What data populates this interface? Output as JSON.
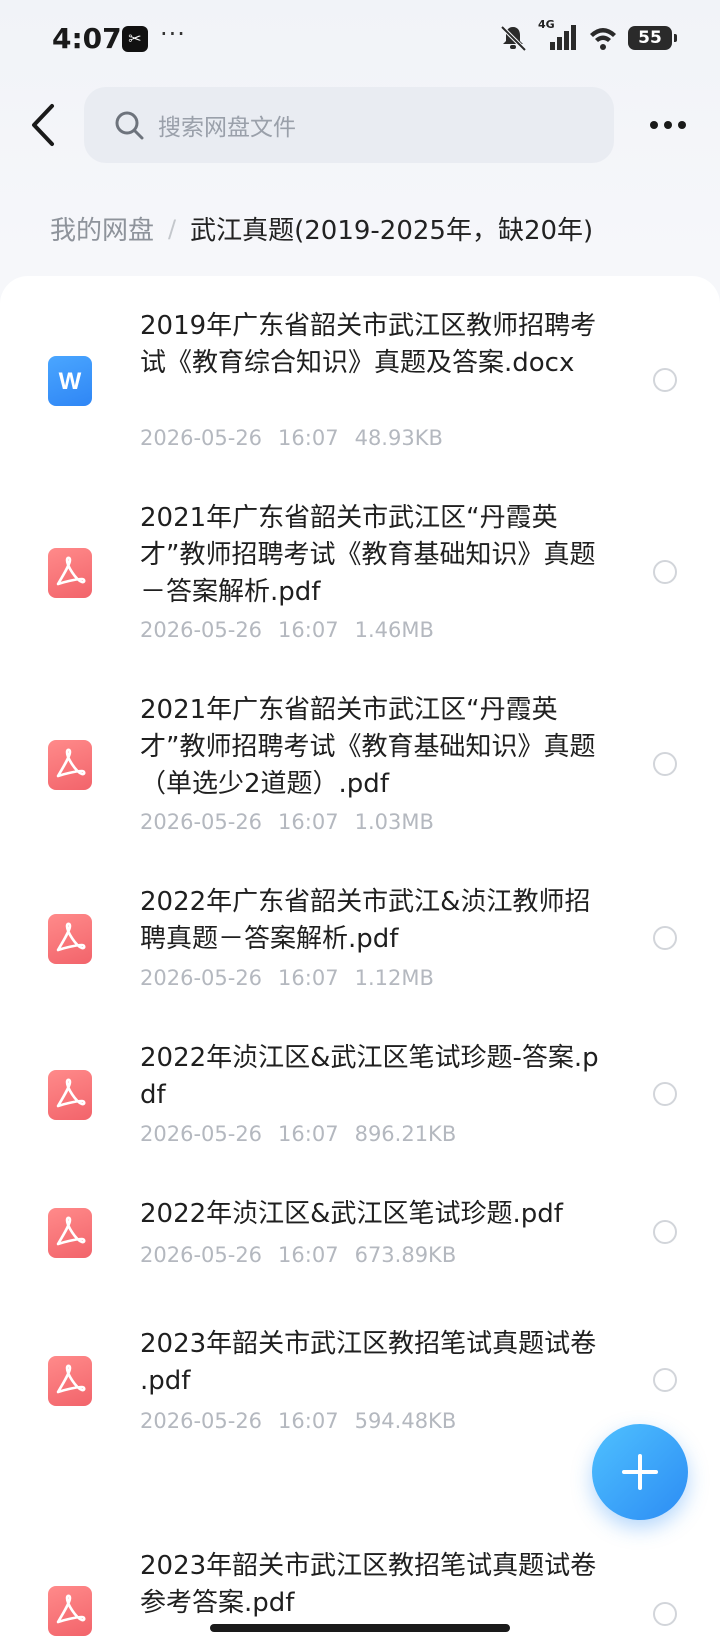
{
  "status_bar": {
    "time": "4:07",
    "dots": "···",
    "network": "4G",
    "battery": "55",
    "app_icon_text": "✂"
  },
  "header": {
    "search_placeholder": "搜索网盘文件"
  },
  "breadcrumb": {
    "root": "我的网盘",
    "separator": "/",
    "current": "武江真题(2019-2025年，缺20年)"
  },
  "files": [
    {
      "name": "2019年广东省韶关市武江区教师招聘考试《教育综合知识》真题及答案.docx",
      "type": "docx",
      "date": "2026-05-26",
      "time": "16:07",
      "size": "48.93KB"
    },
    {
      "name": "2021年广东省韶关市武江区“丹霞英才”教师招聘考试《教育基础知识》真题－答案解析.pdf",
      "type": "pdf",
      "date": "2026-05-26",
      "time": "16:07",
      "size": "1.46MB"
    },
    {
      "name": "2021年广东省韶关市武江区“丹霞英才”教师招聘考试《教育基础知识》真题（单选少2道题）.pdf",
      "type": "pdf",
      "date": "2026-05-26",
      "time": "16:07",
      "size": "1.03MB"
    },
    {
      "name": "2022年广东省韶关市武江&浈江教师招聘真题－答案解析.pdf",
      "type": "pdf",
      "date": "2026-05-26",
      "time": "16:07",
      "size": "1.12MB"
    },
    {
      "name": "2022年浈江区&武江区笔试珍题-答案.pdf",
      "type": "pdf",
      "date": "2026-05-26",
      "time": "16:07",
      "size": "896.21KB"
    },
    {
      "name": "2022年浈江区&武江区笔试珍题.pdf",
      "type": "pdf",
      "date": "2026-05-26",
      "time": "16:07",
      "size": "673.89KB"
    },
    {
      "name": "2023年韶关市武江区教招笔试真题试卷 .pdf",
      "type": "pdf",
      "date": "2026-05-26",
      "time": "16:07",
      "size": "594.48KB"
    },
    {
      "name": "2023年韶关市武江区教招笔试真题试卷参考答案.pdf",
      "type": "pdf",
      "date": "",
      "time": "",
      "size": ""
    }
  ],
  "colors": {
    "accent": "#2c8cf4",
    "pdf": "#f2646b",
    "docx": "#2f86f5",
    "meta": "#b4b8bf"
  }
}
